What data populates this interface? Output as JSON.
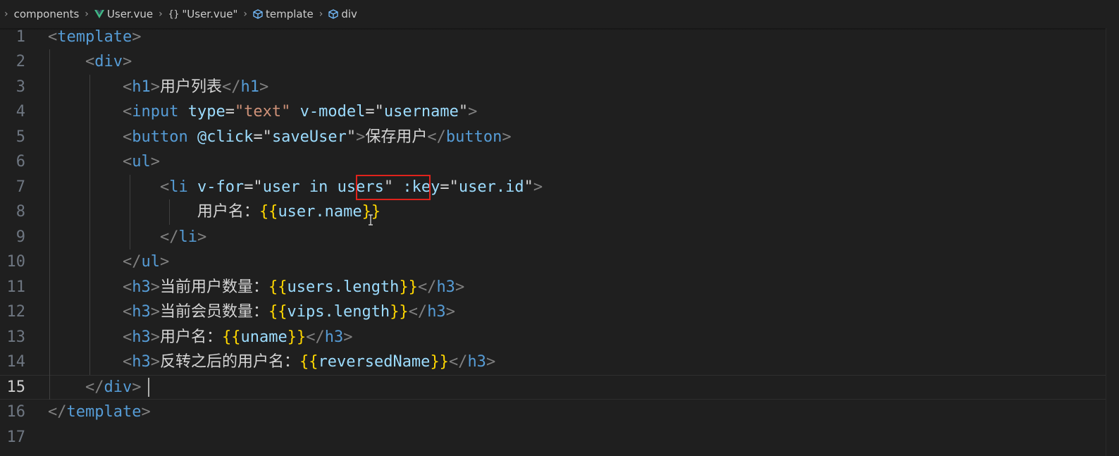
{
  "breadcrumb": {
    "items": [
      {
        "label": "components",
        "icon": "chevron-right-icon"
      },
      {
        "label": "User.vue",
        "icon": "vue-icon"
      },
      {
        "label": "\"User.vue\"",
        "icon": "braces-icon"
      },
      {
        "label": "template",
        "icon": "cube-icon"
      },
      {
        "label": "div",
        "icon": "cube-icon"
      }
    ],
    "braces_glyph": "{}"
  },
  "editor": {
    "active_line": 15,
    "line_numbers": [
      "1",
      "2",
      "3",
      "4",
      "5",
      "6",
      "7",
      "8",
      "9",
      "10",
      "11",
      "12",
      "13",
      "14",
      "15",
      "16",
      "17"
    ],
    "lines": [
      [
        {
          "t": "<",
          "c": "punc"
        },
        {
          "t": "template",
          "c": "tag"
        },
        {
          "t": ">",
          "c": "punc"
        }
      ],
      [
        {
          "t": "    "
        },
        {
          "t": "<",
          "c": "punc"
        },
        {
          "t": "div",
          "c": "tag"
        },
        {
          "t": ">",
          "c": "punc"
        }
      ],
      [
        {
          "t": "        "
        },
        {
          "t": "<",
          "c": "punc"
        },
        {
          "t": "h1",
          "c": "tag"
        },
        {
          "t": ">",
          "c": "punc"
        },
        {
          "t": "用户列表",
          "c": "text"
        },
        {
          "t": "</",
          "c": "punc"
        },
        {
          "t": "h1",
          "c": "tag"
        },
        {
          "t": ">",
          "c": "punc"
        }
      ],
      [
        {
          "t": "        "
        },
        {
          "t": "<",
          "c": "punc"
        },
        {
          "t": "input",
          "c": "tag"
        },
        {
          "t": " "
        },
        {
          "t": "type",
          "c": "attr"
        },
        {
          "t": "=",
          "c": "text"
        },
        {
          "t": "\"text\"",
          "c": "str"
        },
        {
          "t": " "
        },
        {
          "t": "v-model",
          "c": "dir"
        },
        {
          "t": "=\"",
          "c": "text"
        },
        {
          "t": "username",
          "c": "var"
        },
        {
          "t": "\"",
          "c": "text"
        },
        {
          "t": ">",
          "c": "punc"
        }
      ],
      [
        {
          "t": "        "
        },
        {
          "t": "<",
          "c": "punc"
        },
        {
          "t": "button",
          "c": "tag"
        },
        {
          "t": " "
        },
        {
          "t": "@click",
          "c": "dir"
        },
        {
          "t": "=\"",
          "c": "text"
        },
        {
          "t": "saveUser",
          "c": "var"
        },
        {
          "t": "\"",
          "c": "text"
        },
        {
          "t": ">",
          "c": "punc"
        },
        {
          "t": "保存用户",
          "c": "text"
        },
        {
          "t": "</",
          "c": "punc"
        },
        {
          "t": "button",
          "c": "tag"
        },
        {
          "t": ">",
          "c": "punc"
        }
      ],
      [
        {
          "t": "        "
        },
        {
          "t": "<",
          "c": "punc"
        },
        {
          "t": "ul",
          "c": "tag"
        },
        {
          "t": ">",
          "c": "punc"
        }
      ],
      [
        {
          "t": "            "
        },
        {
          "t": "<",
          "c": "punc"
        },
        {
          "t": "li",
          "c": "tag"
        },
        {
          "t": " "
        },
        {
          "t": "v-for",
          "c": "dir"
        },
        {
          "t": "=\"",
          "c": "text"
        },
        {
          "t": "user in users",
          "c": "var"
        },
        {
          "t": "\"",
          "c": "text"
        },
        {
          "t": " "
        },
        {
          "t": ":key",
          "c": "dir"
        },
        {
          "t": "=\"",
          "c": "text"
        },
        {
          "t": "user.id",
          "c": "var"
        },
        {
          "t": "\"",
          "c": "text"
        },
        {
          "t": ">",
          "c": "punc"
        }
      ],
      [
        {
          "t": "                "
        },
        {
          "t": "用户名：",
          "c": "text"
        },
        {
          "t": "{{",
          "c": "brace"
        },
        {
          "t": "user.name",
          "c": "var"
        },
        {
          "t": "}}",
          "c": "brace"
        }
      ],
      [
        {
          "t": "            "
        },
        {
          "t": "</",
          "c": "punc"
        },
        {
          "t": "li",
          "c": "tag"
        },
        {
          "t": ">",
          "c": "punc"
        }
      ],
      [
        {
          "t": "        "
        },
        {
          "t": "</",
          "c": "punc"
        },
        {
          "t": "ul",
          "c": "tag"
        },
        {
          "t": ">",
          "c": "punc"
        }
      ],
      [
        {
          "t": "        "
        },
        {
          "t": "<",
          "c": "punc"
        },
        {
          "t": "h3",
          "c": "tag"
        },
        {
          "t": ">",
          "c": "punc"
        },
        {
          "t": "当前用户数量：",
          "c": "text"
        },
        {
          "t": "{{",
          "c": "brace"
        },
        {
          "t": "users.length",
          "c": "var"
        },
        {
          "t": "}}",
          "c": "brace"
        },
        {
          "t": "</",
          "c": "punc"
        },
        {
          "t": "h3",
          "c": "tag"
        },
        {
          "t": ">",
          "c": "punc"
        }
      ],
      [
        {
          "t": "        "
        },
        {
          "t": "<",
          "c": "punc"
        },
        {
          "t": "h3",
          "c": "tag"
        },
        {
          "t": ">",
          "c": "punc"
        },
        {
          "t": "当前会员数量：",
          "c": "text"
        },
        {
          "t": "{{",
          "c": "brace"
        },
        {
          "t": "vips.length",
          "c": "var"
        },
        {
          "t": "}}",
          "c": "brace"
        },
        {
          "t": "</",
          "c": "punc"
        },
        {
          "t": "h3",
          "c": "tag"
        },
        {
          "t": ">",
          "c": "punc"
        }
      ],
      [
        {
          "t": "        "
        },
        {
          "t": "<",
          "c": "punc"
        },
        {
          "t": "h3",
          "c": "tag"
        },
        {
          "t": ">",
          "c": "punc"
        },
        {
          "t": "用户名：",
          "c": "text"
        },
        {
          "t": "{{",
          "c": "brace"
        },
        {
          "t": "uname",
          "c": "var"
        },
        {
          "t": "}}",
          "c": "brace"
        },
        {
          "t": "</",
          "c": "punc"
        },
        {
          "t": "h3",
          "c": "tag"
        },
        {
          "t": ">",
          "c": "punc"
        }
      ],
      [
        {
          "t": "        "
        },
        {
          "t": "<",
          "c": "punc"
        },
        {
          "t": "h3",
          "c": "tag"
        },
        {
          "t": ">",
          "c": "punc"
        },
        {
          "t": "反转之后的用户名：",
          "c": "text"
        },
        {
          "t": "{{",
          "c": "brace"
        },
        {
          "t": "reversedName",
          "c": "var"
        },
        {
          "t": "}}",
          "c": "brace"
        },
        {
          "t": "</",
          "c": "punc"
        },
        {
          "t": "h3",
          "c": "tag"
        },
        {
          "t": ">",
          "c": "punc"
        }
      ],
      [
        {
          "t": "    "
        },
        {
          "t": "</",
          "c": "punc"
        },
        {
          "t": "div",
          "c": "tag"
        },
        {
          "t": ">",
          "c": "punc"
        }
      ],
      [
        {
          "t": "</",
          "c": "punc"
        },
        {
          "t": "template",
          "c": "tag"
        },
        {
          "t": ">",
          "c": "punc"
        }
      ],
      []
    ]
  },
  "colors": {
    "background": "#1f1f1f",
    "tag": "#569cd6",
    "attribute": "#9cdcfe",
    "string": "#ce9178",
    "punctuation": "#808080",
    "brace": "#ffd700",
    "highlight_box": "#e0231c"
  },
  "annotation": {
    "highlighted_text": "users",
    "line": 7
  }
}
